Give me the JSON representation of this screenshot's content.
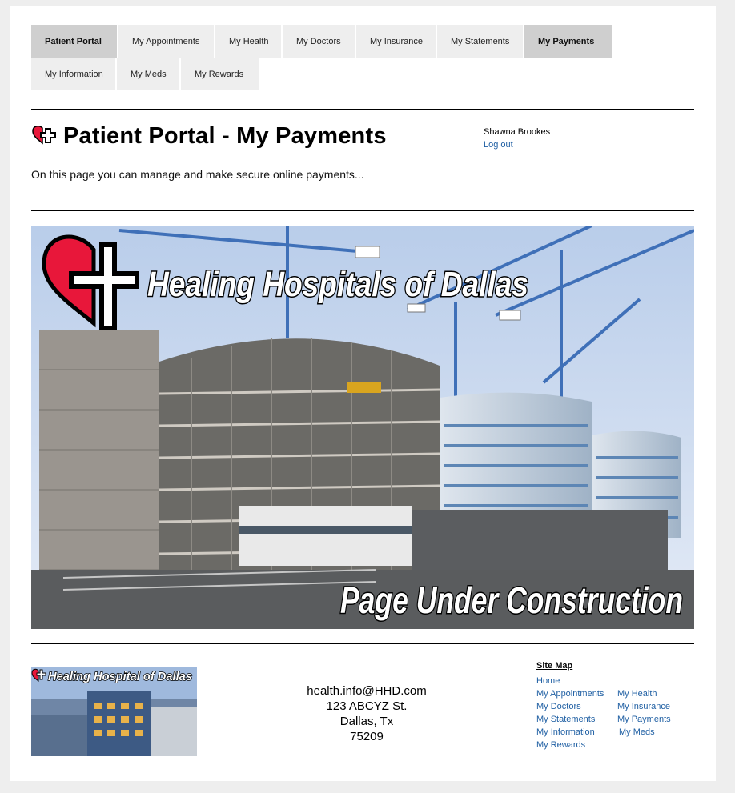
{
  "nav": {
    "row1": [
      "Patient Portal",
      "My Appointments",
      "My Health",
      "My Doctors",
      "My Insurance",
      "My Statements",
      "My Payments"
    ],
    "row2": [
      "My Information",
      "My Meds",
      "My Rewards"
    ]
  },
  "header": {
    "title": "Patient Portal - My Payments",
    "user_name": "Shawna Brookes",
    "logout_label": "Log out",
    "intro": "On this page you can manage and make secure online payments..."
  },
  "banner": {
    "brand_text": "Healing Hospitals of Dallas",
    "construction_text": "Page Under Construction"
  },
  "footer": {
    "image_text": "Healing Hospital of Dallas",
    "email": "health.info@HHD.com",
    "street": "123 ABCYZ St.",
    "city": "Dallas, Tx",
    "zip": "75209",
    "sitemap": {
      "title": "Site Map",
      "home": "Home",
      "col1": [
        "My Appointments",
        "My Doctors",
        "My Statements",
        "My Information",
        "My Rewards"
      ],
      "col2": [
        "My Health",
        "My Insurance",
        "My Payments",
        "My Meds"
      ]
    }
  },
  "colors": {
    "heart": "#e8173a",
    "link": "#1f5fa3",
    "active_tab": "#cfcfcf",
    "tab": "#eeeeee"
  }
}
